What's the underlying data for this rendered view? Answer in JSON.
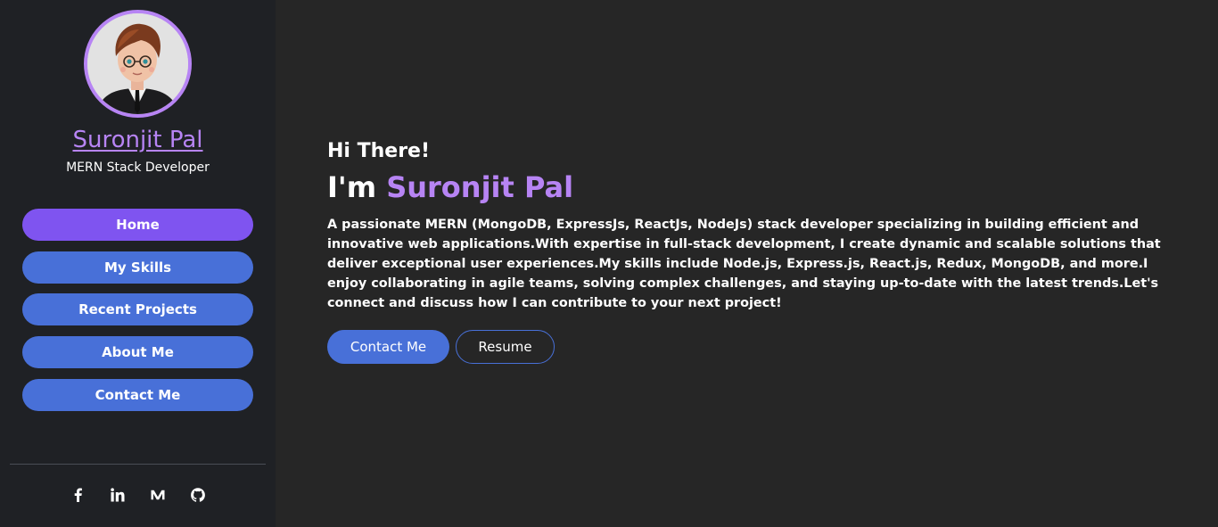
{
  "profile": {
    "name": "Suronjit Pal",
    "role": "MERN Stack Developer"
  },
  "nav": {
    "items": [
      {
        "label": "Home",
        "active": true
      },
      {
        "label": "My Skills",
        "active": false
      },
      {
        "label": "Recent Projects",
        "active": false
      },
      {
        "label": "About Me",
        "active": false
      },
      {
        "label": "Contact Me",
        "active": false
      }
    ]
  },
  "social": {
    "icons": [
      "facebook-icon",
      "linkedin-icon",
      "medium-icon",
      "github-icon"
    ]
  },
  "hero": {
    "greeting": "Hi There!",
    "im_prefix": "I'm ",
    "name": "Suronjit Pal",
    "description": "A passionate MERN (MongoDB, ExpressJs, ReactJs, NodeJs) stack developer specializing in building efficient and innovative web applications.With expertise in full-stack development, I create dynamic and scalable solutions that deliver exceptional user experiences.My skills include Node.js, Express.js, React.js, Redux, MongoDB, and more.I enjoy collaborating in agile teams, solving complex challenges, and staying up-to-date with the latest trends.Let's connect and discuss how I can contribute to your next project!",
    "contact_label": "Contact Me",
    "resume_label": "Resume"
  },
  "colors": {
    "accent": "#b784f4",
    "primary_button": "#4870d8",
    "active_button": "#7f54f0",
    "sidebar_bg": "#1f2125",
    "main_bg": "#262626"
  }
}
